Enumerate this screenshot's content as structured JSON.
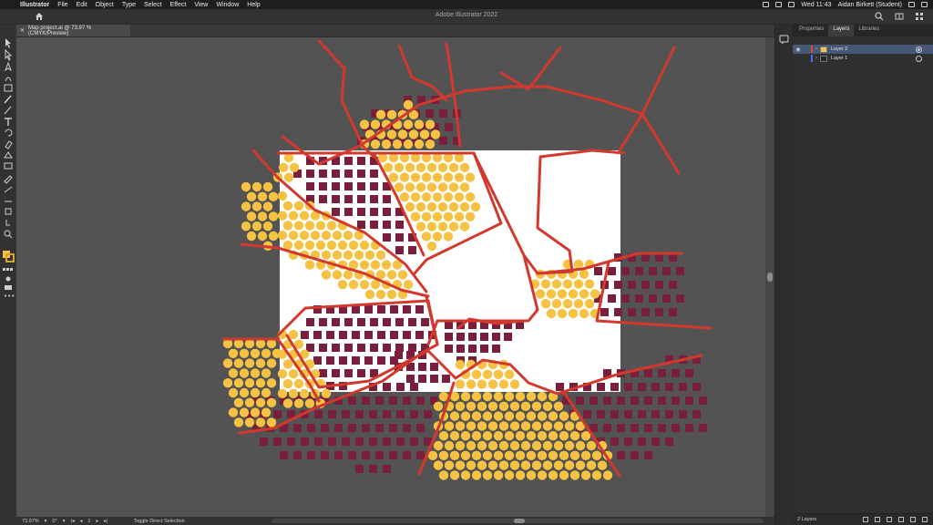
{
  "menubar": {
    "app_name": "Illustrator",
    "items": [
      "File",
      "Edit",
      "Object",
      "Type",
      "Select",
      "Effect",
      "View",
      "Window",
      "Help"
    ],
    "clock": "Wed 11:43",
    "user": "Aidan Birkett (Student)"
  },
  "window": {
    "title": "Adobe Illustrator 2022"
  },
  "document_tab": {
    "name": "Map project.ai @ 73.97 % (CMYK/Preview)"
  },
  "tools": [
    "selection-tool-icon",
    "direct-selection-tool-icon",
    "pen-tool-icon",
    "curvature-tool-icon",
    "rectangle-tool-icon",
    "paintbrush-tool-icon",
    "pencil-tool-icon",
    "type-tool-icon",
    "rotate-tool-icon",
    "eraser-tool-icon",
    "shape-builder-tool-icon",
    "gradient-tool-icon",
    "eyedropper-tool-icon",
    "blend-tool-icon",
    "width-tool-icon",
    "artboard-tool-icon",
    "hand-tool-icon",
    "zoom-tool-icon"
  ],
  "colors": {
    "fill": "#F6C243",
    "stroke": "#D4A22E",
    "artboard": "#FFFFFF",
    "pasteboard": "#535353",
    "line": "#D2392E",
    "square": "#7A1F3B",
    "dot": "#F6C243"
  },
  "panels": {
    "tabs": [
      "Properties",
      "Layers",
      "Libraries"
    ],
    "active_tab": "Layers",
    "layers": [
      {
        "name": "Layer 2",
        "color": "#E0483C",
        "selected": true
      },
      {
        "name": "Layer 1",
        "color": "#4F6FE8",
        "selected": false
      }
    ],
    "footer_count": "2 Layers"
  },
  "statusbar": {
    "zoom": "73.97%",
    "rotation": "0°",
    "artboard_number": "1",
    "tool_hint": "Toggle Direct Selection"
  }
}
